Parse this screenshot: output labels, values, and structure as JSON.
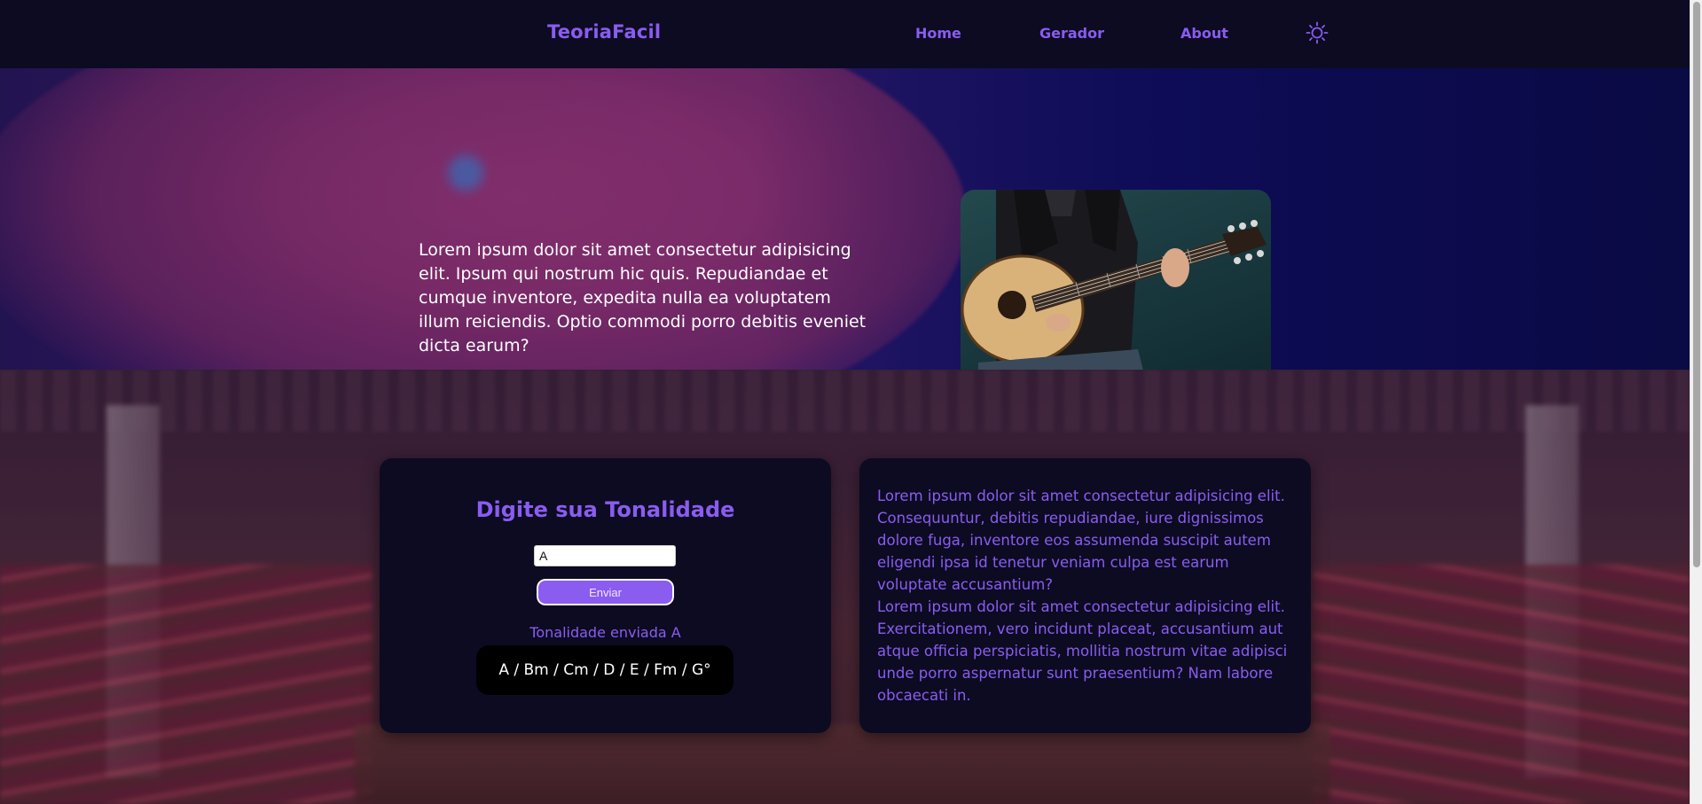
{
  "nav": {
    "brand": "TeoriaFacil",
    "links": [
      "Home",
      "Gerador",
      "About"
    ],
    "theme_icon": "sun-icon"
  },
  "hero": {
    "text": "Lorem ipsum dolor sit amet consectetur adipisicing elit. Ipsum qui nostrum hic quis. Repudiandae et cumque inventore, expedita nulla ea voluptatem illum reiciendis. Optio commodi porro debitis eveniet dicta earum?",
    "image_icon": "guitar-photo"
  },
  "generator": {
    "title": "Digite sua Tonalidade",
    "input_value": "A",
    "button_label": "Enviar",
    "sent_label": "Tonalidade enviada A",
    "chords": "A / Bm / Cm / D / E / Fm / G°"
  },
  "info": {
    "paragraph1": "Lorem ipsum dolor sit amet consectetur adipisicing elit. Consequuntur, debitis repudiandae, iure dignissimos dolore fuga, inventore eos assumenda suscipit autem eligendi ipsa id tenetur veniam culpa est earum voluptate accusantium?",
    "paragraph2": "Lorem ipsum dolor sit amet consectetur adipisicing elit. Exercitationem, vero incidunt placeat, accusantium aut atque officia perspiciatis, mollitia nostrum vitae adipisci unde porro aspernatur sunt praesentium? Nam labore obcaecati in."
  },
  "colors": {
    "accent": "#8a5cf0",
    "nav_bg": "#0c0b22",
    "card_bg": "#0c0b22"
  }
}
